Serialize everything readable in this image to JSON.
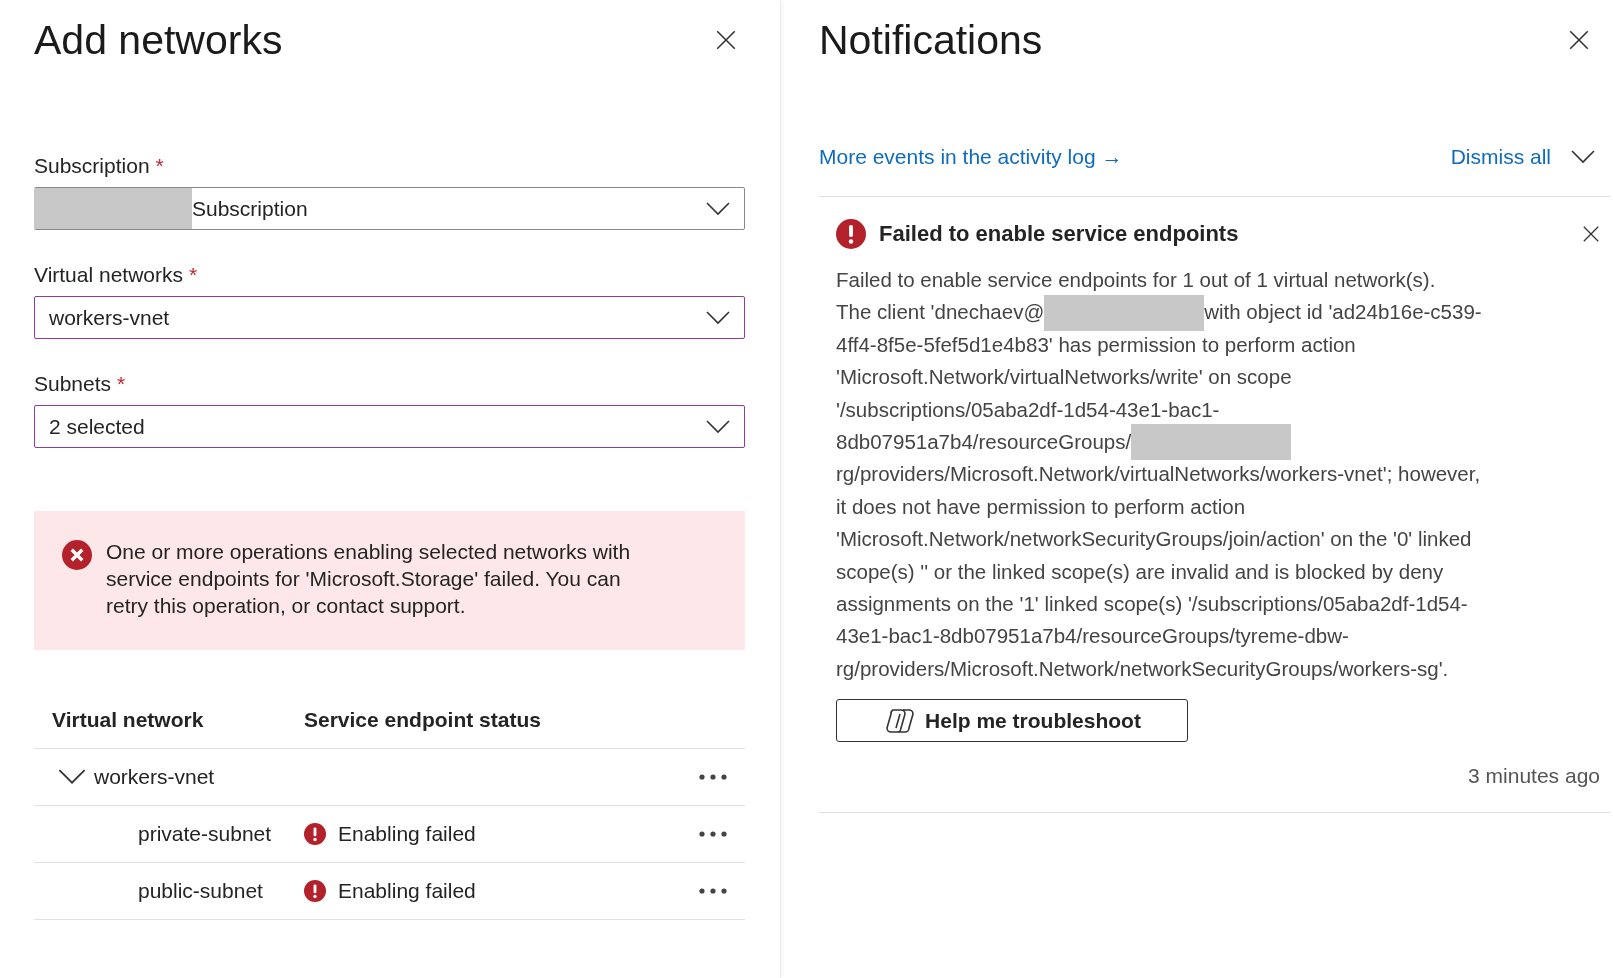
{
  "add_networks": {
    "title": "Add networks",
    "fields": [
      {
        "label": "Subscription",
        "required_mark": "*",
        "highlighted": false,
        "value": [
          {
            "kind": "redacted"
          },
          {
            "kind": "text",
            "text": "Subscription"
          }
        ]
      },
      {
        "label": "Virtual networks",
        "required_mark": "*",
        "highlighted": true,
        "value": [
          {
            "kind": "text",
            "text": "workers-vnet"
          }
        ]
      },
      {
        "label": "Subnets",
        "required_mark": "*",
        "highlighted": true,
        "value": [
          {
            "kind": "text",
            "text": "2 selected"
          }
        ]
      }
    ],
    "error_banner": {
      "kind": "error",
      "message": "One or more operations enabling selected networks with service endpoints for 'Microsoft.Storage' failed. You can retry this operation, or contact support."
    },
    "table": {
      "columns": [
        "Virtual network",
        "Service endpoint status"
      ],
      "rows": [
        {
          "name": "workers-vnet",
          "expanded": true,
          "children": [
            {
              "name": "private-subnet",
              "kind": "error",
              "status": "Enabling failed"
            },
            {
              "name": "public-subnet",
              "kind": "error",
              "status": "Enabling failed"
            }
          ]
        }
      ]
    }
  },
  "notifications": {
    "title": "Notifications",
    "activity_link": "More events in the activity log →",
    "dismiss_all": "Dismiss all",
    "items": [
      {
        "kind": "error",
        "title": "Failed to enable service endpoints",
        "lines": [
          [
            {
              "kind": "text",
              "text": "Failed to enable service endpoints for 1 out of 1 virtual network(s)."
            }
          ],
          [
            {
              "kind": "text",
              "text": "The client 'dnechaev@"
            },
            {
              "kind": "redacted"
            },
            {
              "kind": "text",
              "text": "with object id 'ad24b16e-c539-"
            }
          ],
          [
            {
              "kind": "text",
              "text": "4ff4-8f5e-5fef5d1e4b83' has permission to perform action"
            }
          ],
          [
            {
              "kind": "text",
              "text": "'Microsoft.Network/virtualNetworks/write' on scope"
            }
          ],
          [
            {
              "kind": "text",
              "text": "'/subscriptions/05aba2df-1d54-43e1-bac1-"
            }
          ],
          [
            {
              "kind": "text",
              "text": "8db07951a7b4/resourceGroups/"
            },
            {
              "kind": "redacted"
            }
          ],
          [
            {
              "kind": "text",
              "text": "rg/providers/Microsoft.Network/virtualNetworks/workers-vnet'; however,"
            }
          ],
          [
            {
              "kind": "text",
              "text": "it does not have permission to perform action"
            }
          ],
          [
            {
              "kind": "text",
              "text": "'Microsoft.Network/networkSecurityGroups/join/action' on the '0' linked"
            }
          ],
          [
            {
              "kind": "text",
              "text": "scope(s) '' or the linked scope(s) are invalid and is blocked by deny"
            }
          ],
          [
            {
              "kind": "text",
              "text": "assignments on the '1' linked scope(s) '/subscriptions/05aba2df-1d54-"
            }
          ],
          [
            {
              "kind": "text",
              "text": "43e1-bac1-8db07951a7b4/resourceGroups/tyreme-dbw-"
            }
          ],
          [
            {
              "kind": "text",
              "text": "rg/providers/Microsoft.Network/networkSecurityGroups/workers-sg'."
            }
          ]
        ],
        "action_button": "Help me troubleshoot",
        "time": "3 minutes ago"
      }
    ]
  }
}
